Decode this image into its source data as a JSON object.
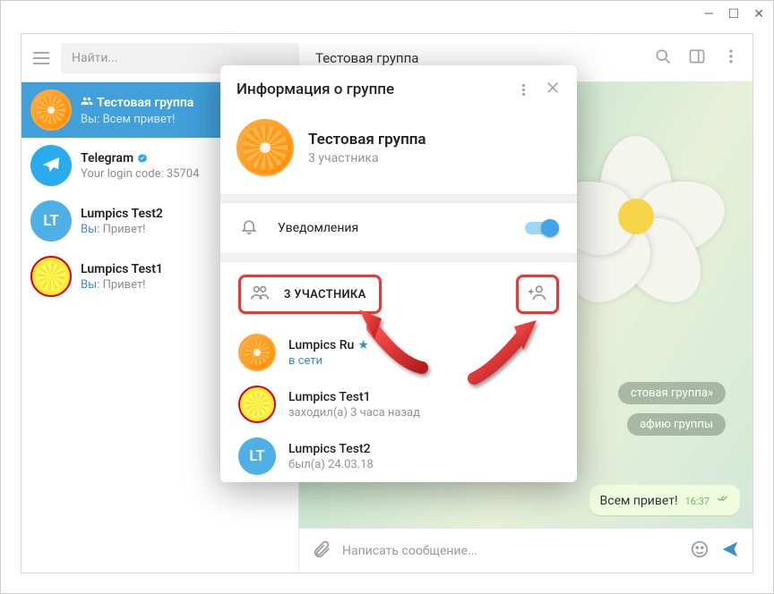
{
  "window": {
    "title": "Тестовая группа"
  },
  "search": {
    "placeholder": "Найти..."
  },
  "chats": [
    {
      "type": "group",
      "title": "Тестовая группа",
      "sub_prefix": "Вы:",
      "sub_text": " Всем привет!"
    },
    {
      "type": "telegram",
      "title": "Telegram",
      "sub_text": "Your login code: 35704"
    },
    {
      "type": "lt",
      "initials": "LT",
      "title": "Lumpics Test2",
      "sub_prefix": "Вы:",
      "sub_text": " Привет!"
    },
    {
      "type": "lemon",
      "title": "Lumpics Test1",
      "sub_prefix": "Вы:",
      "sub_text": " Привет!"
    }
  ],
  "chat_area": {
    "pill1": "стовая группа»",
    "pill2": "афию группы",
    "bubble_text": "Всем привет!",
    "bubble_time": "16:37",
    "composer_placeholder": "Написать сообщение..."
  },
  "modal": {
    "title": "Информация о группе",
    "group_name": "Тестовая группа",
    "members_sub": "3 участника",
    "notifications_label": "Уведомления",
    "members_header": "3 УЧАСТНИКА",
    "members": [
      {
        "name": "Lumpics Ru",
        "status": "в сети",
        "online": true,
        "avatar": "orange",
        "admin": true
      },
      {
        "name": "Lumpics Test1",
        "status": "заходил(а) 3 часа назад",
        "online": false,
        "avatar": "lemon"
      },
      {
        "name": "Lumpics Test2",
        "status": "был(а) 24.03.18",
        "online": false,
        "avatar": "lt",
        "initials": "LT"
      }
    ]
  }
}
